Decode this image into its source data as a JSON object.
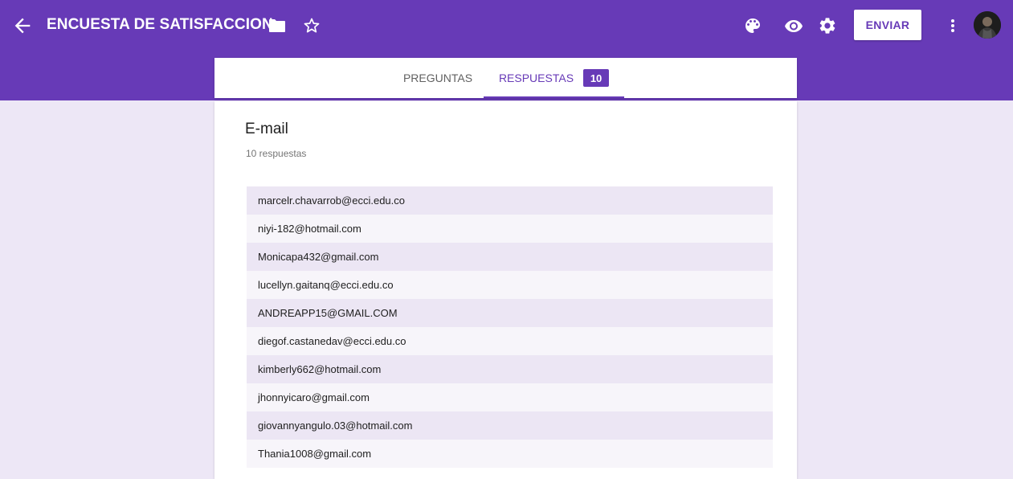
{
  "header": {
    "title": "ENCUESTA DE SATISFACCION",
    "send_label": "ENVIAR",
    "icons": [
      "back-arrow-icon",
      "folder-icon",
      "star-outline-icon",
      "palette-icon",
      "eye-icon",
      "gear-icon",
      "more-vert-icon"
    ]
  },
  "tabs": {
    "questions_label": "PREGUNTAS",
    "responses_label": "RESPUESTAS",
    "responses_count": "10",
    "active": "RESPUESTAS"
  },
  "question": {
    "title": "E-mail",
    "count_text": "10 respuestas",
    "answers": [
      "marcelr.chavarrob@ecci.edu.co",
      "niyi-182@hotmail.com",
      "Monicapa432@gmail.com",
      "lucellyn.gaitanq@ecci.edu.co",
      "ANDREAPP15@GMAIL.COM",
      "diegof.castanedav@ecci.edu.co",
      "kimberly662@hotmail.com",
      "jhonnyicaro@gmail.com",
      "giovannyangulo.03@hotmail.com",
      "Thania1008@gmail.com"
    ]
  },
  "colors": {
    "primary": "#673ab7",
    "background": "#ede7f6",
    "row_odd": "#ece6f4",
    "row_even": "#f7f5fa"
  }
}
